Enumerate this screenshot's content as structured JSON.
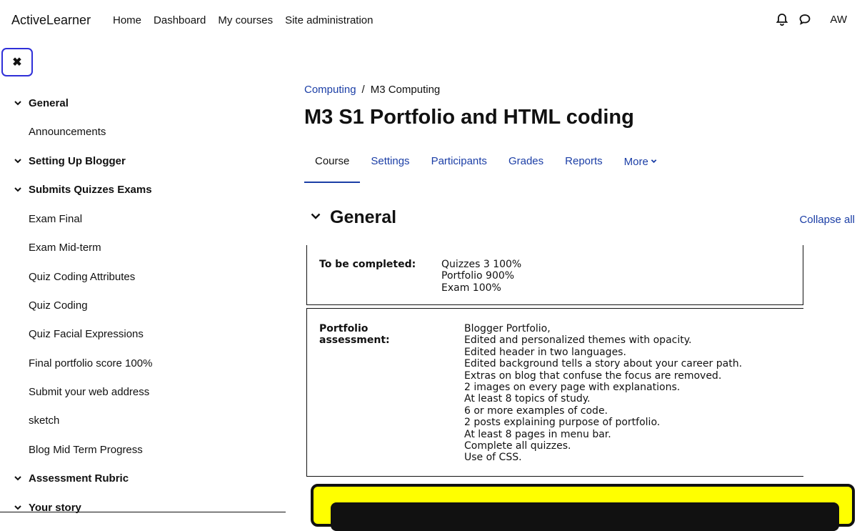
{
  "topnav": {
    "brand": "ActiveLearner",
    "links": [
      "Home",
      "Dashboard",
      "My courses",
      "Site administration"
    ],
    "user_initials": "AW",
    "icons": [
      "bell-icon",
      "chat-icon"
    ]
  },
  "drawer": {
    "close_glyph": "✖"
  },
  "sidebar": {
    "items": [
      {
        "type": "section",
        "label": "General"
      },
      {
        "type": "activity",
        "label": "Announcements"
      },
      {
        "type": "section",
        "label": "Setting Up Blogger"
      },
      {
        "type": "section",
        "label": "Submits Quizzes Exams"
      },
      {
        "type": "activity",
        "label": "Exam Final"
      },
      {
        "type": "activity",
        "label": "Exam Mid-term"
      },
      {
        "type": "activity",
        "label": "Quiz Coding Attributes"
      },
      {
        "type": "activity",
        "label": "Quiz Coding"
      },
      {
        "type": "activity",
        "label": "Quiz Facial Expressions"
      },
      {
        "type": "activity",
        "label": "Final portfolio score 100%"
      },
      {
        "type": "activity",
        "label": "Submit your web address"
      },
      {
        "type": "activity",
        "label": "sketch"
      },
      {
        "type": "activity",
        "label": "Blog Mid Term Progress"
      },
      {
        "type": "section",
        "label": "Assessment Rubric"
      },
      {
        "type": "section",
        "label": "Your story"
      }
    ]
  },
  "breadcrumb": {
    "parent": "Computing",
    "separator": "/",
    "current": "M3 Computing"
  },
  "page_title": "M3 S1 Portfolio and HTML coding",
  "tabs": {
    "course": "Course",
    "settings": "Settings",
    "participants": "Participants",
    "grades": "Grades",
    "reports": "Reports",
    "more": "More"
  },
  "section": {
    "title": "General",
    "collapse_all": "Collapse all"
  },
  "completion": {
    "label": "To be completed:",
    "values": [
      "Quizzes 3 100%",
      "Portfolio 900%",
      "Exam 100%"
    ]
  },
  "portfolio": {
    "label_line1": "Portfolio",
    "label_line2": "assessment:",
    "values": [
      "Blogger Portfolio,",
      "Edited and personalized themes with opacity.",
      "Edited header in two languages.",
      "Edited background tells a story about your career path.",
      "Extras on blog that confuse the focus are removed.",
      "2 images on every page with explanations.",
      "At least 8 topics of study.",
      "6 or more examples of code.",
      "2 posts explaining purpose of portfolio.",
      "At least 8 pages in menu bar.",
      "Complete all quizzes.",
      "Use of CSS."
    ]
  },
  "colors": {
    "link": "#1b3ea6",
    "highlight_block": "#ffff00",
    "focus_ring": "#2f2fd8"
  }
}
